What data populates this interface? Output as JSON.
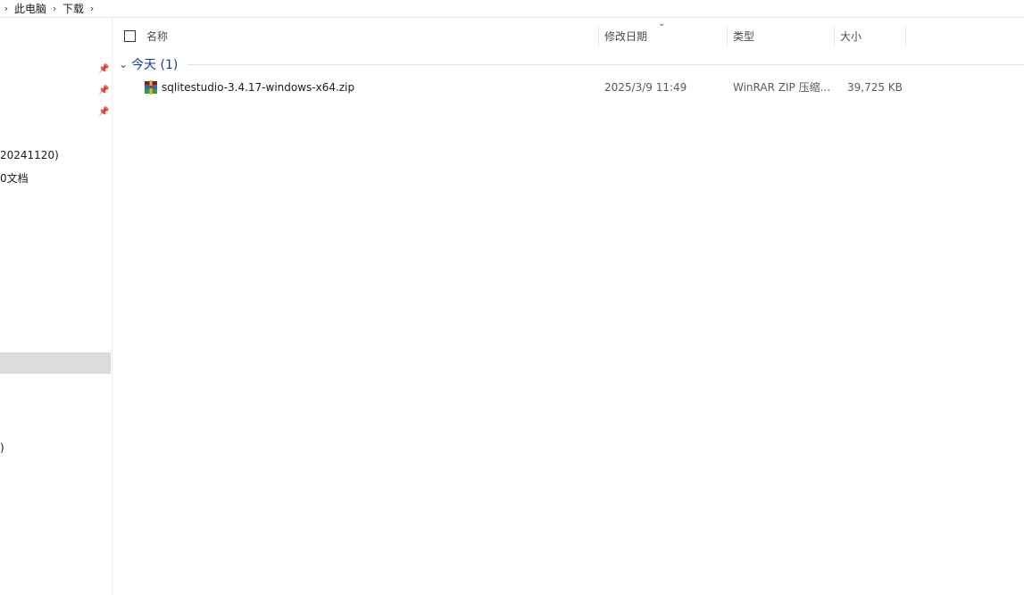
{
  "breadcrumb": {
    "items": [
      "此电脑",
      "下载"
    ]
  },
  "sidebar": {
    "partial_items": [
      "20241120)",
      "0文档",
      ")"
    ]
  },
  "columns": {
    "name": "名称",
    "modified": "修改日期",
    "type": "类型",
    "size": "大小"
  },
  "group": {
    "label": "今天 (1)"
  },
  "files": [
    {
      "name": "sqlitestudio-3.4.17-windows-x64.zip",
      "modified": "2025/3/9 11:49",
      "type": "WinRAR ZIP 压缩...",
      "size": "39,725 KB",
      "icon": "winrar-zip-icon"
    }
  ],
  "colors": {
    "group_text": "#1e3c8c",
    "selected_bg": "#dcdcdc"
  }
}
